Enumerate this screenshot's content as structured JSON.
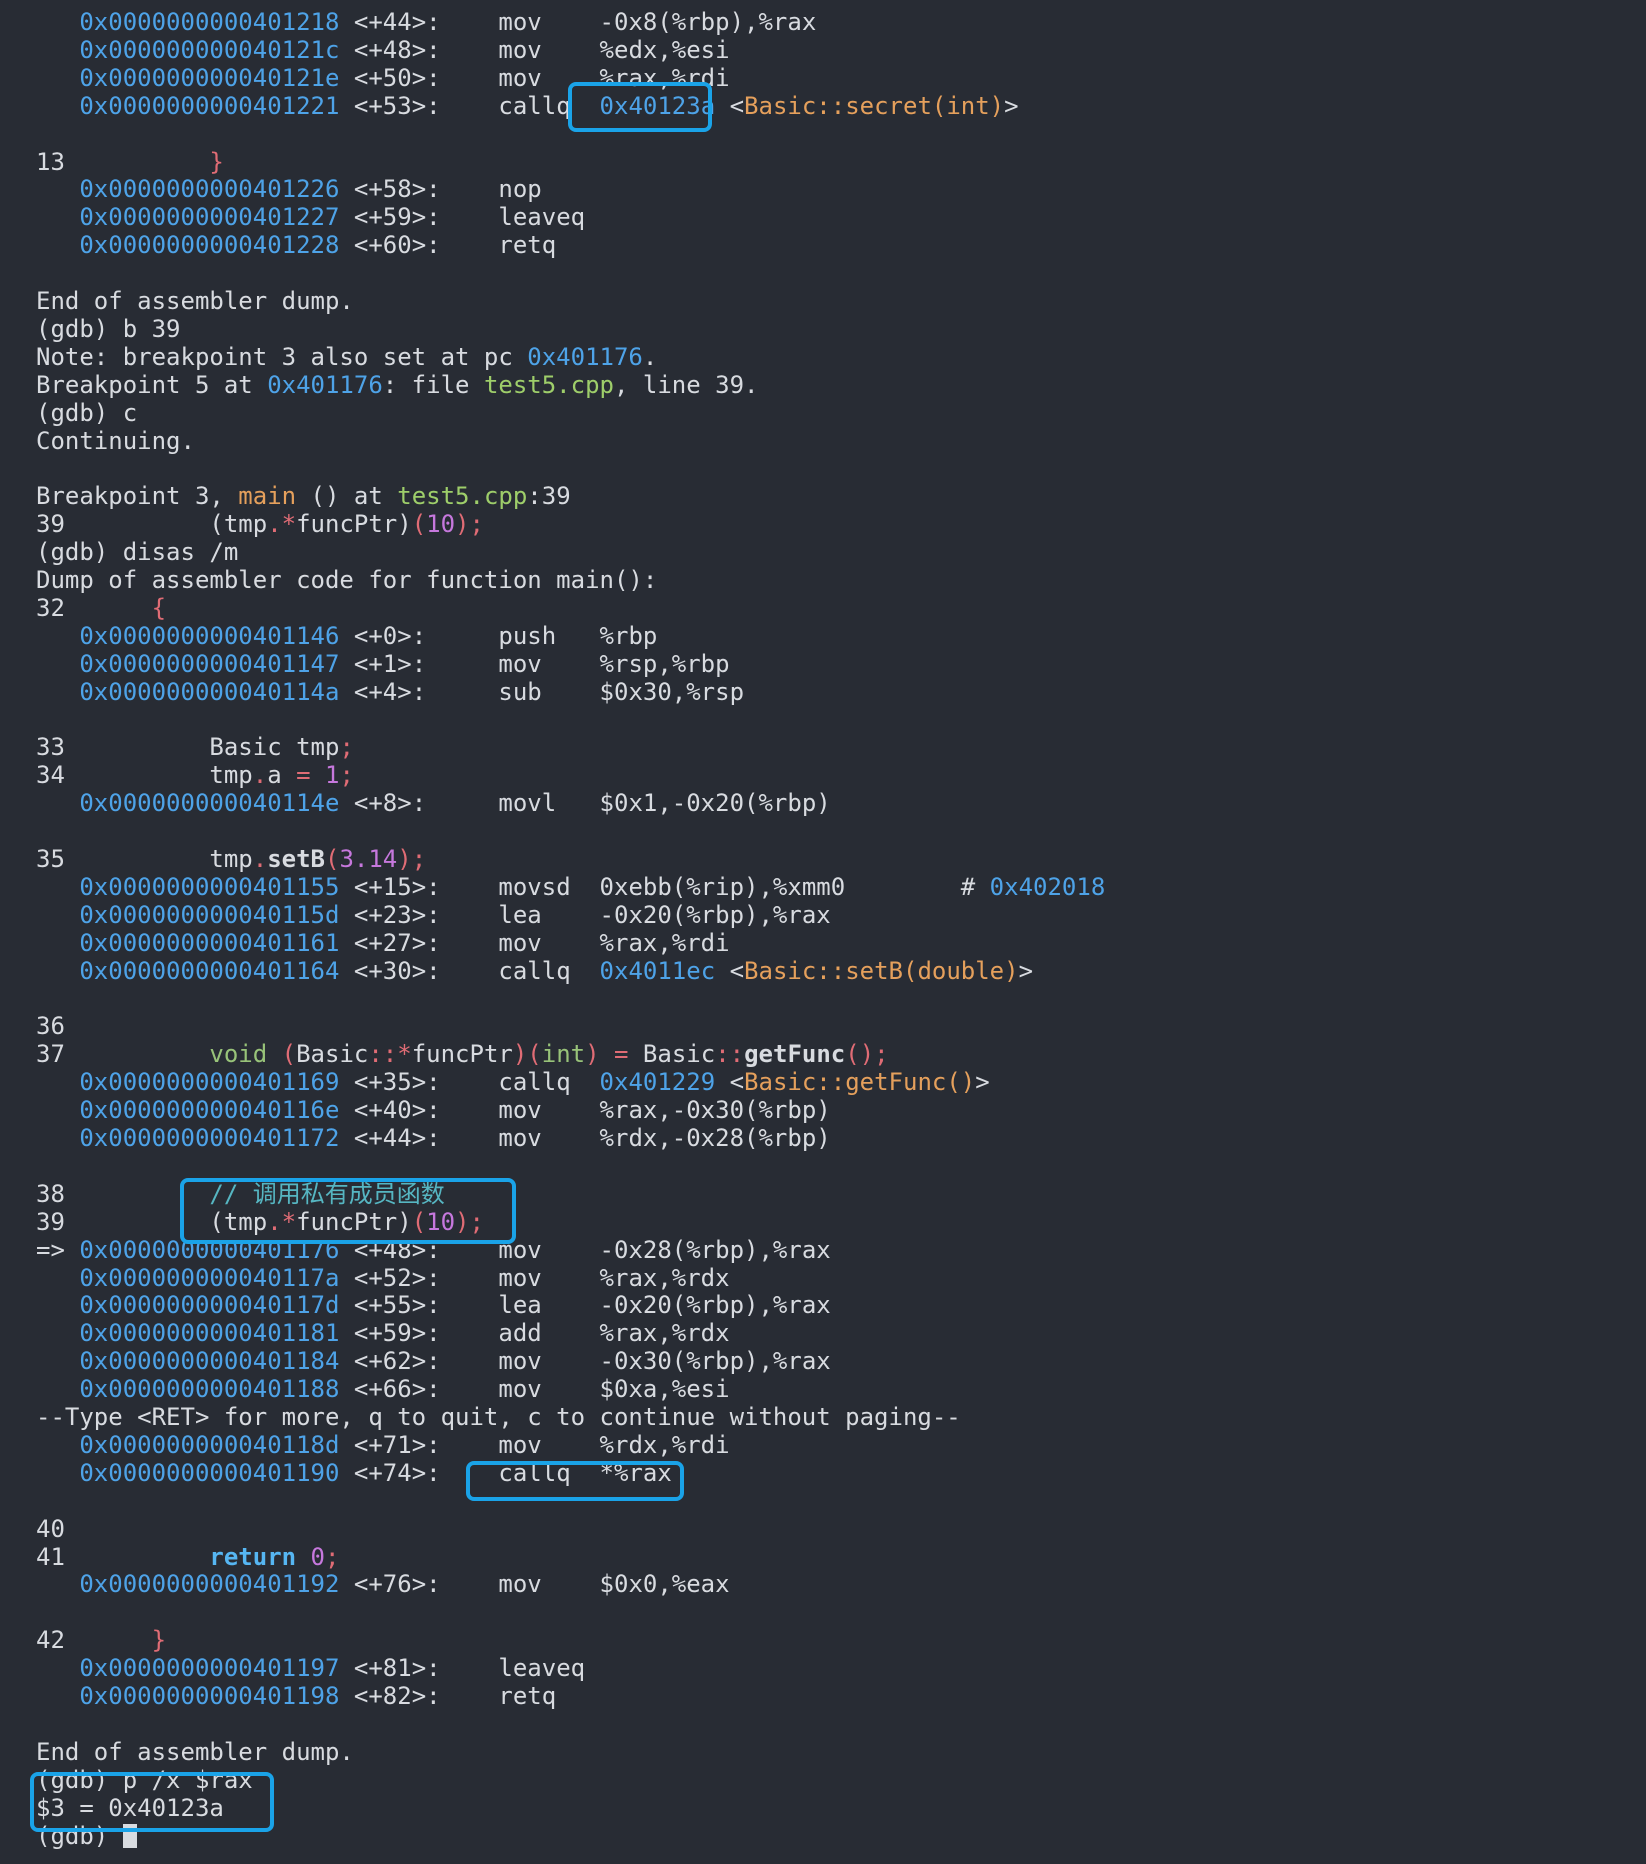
{
  "terminal": {
    "lines": [
      [
        {
          "t": "   "
        },
        {
          "t": "0x0000000000401218",
          "c": "addr"
        },
        {
          "t": " <+44>:    mov    -0x8(%rbp),%rax"
        }
      ],
      [
        {
          "t": "   "
        },
        {
          "t": "0x000000000040121c",
          "c": "addr"
        },
        {
          "t": " <+48>:    mov    %edx,%esi"
        }
      ],
      [
        {
          "t": "   "
        },
        {
          "t": "0x000000000040121e",
          "c": "addr"
        },
        {
          "t": " <+50>:    mov    %rax,%rdi"
        }
      ],
      [
        {
          "t": "   "
        },
        {
          "t": "0x0000000000401221",
          "c": "addr"
        },
        {
          "t": " <+53>:    callq  "
        },
        {
          "t": "0x40123a",
          "c": "addr"
        },
        {
          "t": " <"
        },
        {
          "t": "Basic::secret(int)",
          "c": "sym"
        },
        {
          "t": ">"
        }
      ],
      [],
      [
        {
          "t": "13          "
        },
        {
          "t": "}",
          "c": "brace"
        }
      ],
      [
        {
          "t": "   "
        },
        {
          "t": "0x0000000000401226",
          "c": "addr"
        },
        {
          "t": " <+58>:    nop"
        }
      ],
      [
        {
          "t": "   "
        },
        {
          "t": "0x0000000000401227",
          "c": "addr"
        },
        {
          "t": " <+59>:    leaveq"
        }
      ],
      [
        {
          "t": "   "
        },
        {
          "t": "0x0000000000401228",
          "c": "addr"
        },
        {
          "t": " <+60>:    retq"
        }
      ],
      [],
      [
        {
          "t": "End of assembler dump."
        }
      ],
      [
        {
          "t": "(gdb) b 39"
        }
      ],
      [
        {
          "t": "Note: breakpoint 3 also set at pc "
        },
        {
          "t": "0x401176",
          "c": "addr"
        },
        {
          "t": "."
        }
      ],
      [
        {
          "t": "Breakpoint 5 at "
        },
        {
          "t": "0x401176",
          "c": "addr"
        },
        {
          "t": ": file "
        },
        {
          "t": "test5.cpp",
          "c": "file"
        },
        {
          "t": ", line 39."
        }
      ],
      [
        {
          "t": "(gdb) c"
        }
      ],
      [
        {
          "t": "Continuing."
        }
      ],
      [],
      [
        {
          "t": "Breakpoint 3, "
        },
        {
          "t": "main",
          "c": "sym"
        },
        {
          "t": " () at "
        },
        {
          "t": "test5.cpp",
          "c": "file"
        },
        {
          "t": ":39"
        }
      ],
      [
        {
          "t": "39          "
        },
        {
          "t": "(tmp"
        },
        {
          "t": ".*",
          "c": "op"
        },
        {
          "t": "funcPtr)"
        },
        {
          "t": "(",
          "c": "op"
        },
        {
          "t": "10",
          "c": "num"
        },
        {
          "t": ");",
          "c": "op"
        }
      ],
      [
        {
          "t": "(gdb) disas /m"
        }
      ],
      [
        {
          "t": "Dump of assembler code for function main():"
        }
      ],
      [
        {
          "t": "32      "
        },
        {
          "t": "{",
          "c": "brace"
        }
      ],
      [
        {
          "t": "   "
        },
        {
          "t": "0x0000000000401146",
          "c": "addr"
        },
        {
          "t": " <+0>:     push   %rbp"
        }
      ],
      [
        {
          "t": "   "
        },
        {
          "t": "0x0000000000401147",
          "c": "addr"
        },
        {
          "t": " <+1>:     mov    %rsp,%rbp"
        }
      ],
      [
        {
          "t": "   "
        },
        {
          "t": "0x000000000040114a",
          "c": "addr"
        },
        {
          "t": " <+4>:     sub    $0x30,%rsp"
        }
      ],
      [],
      [
        {
          "t": "33          Basic tmp"
        },
        {
          "t": ";",
          "c": "op"
        }
      ],
      [
        {
          "t": "34          tmp"
        },
        {
          "t": ".",
          "c": "op"
        },
        {
          "t": "a "
        },
        {
          "t": "=",
          "c": "op"
        },
        {
          "t": " "
        },
        {
          "t": "1",
          "c": "num"
        },
        {
          "t": ";",
          "c": "op"
        }
      ],
      [
        {
          "t": "   "
        },
        {
          "t": "0x000000000040114e",
          "c": "addr"
        },
        {
          "t": " <+8>:     movl   $0x1,-0x20(%rbp)"
        }
      ],
      [],
      [
        {
          "t": "35          tmp"
        },
        {
          "t": ".",
          "c": "op"
        },
        {
          "t": "setB",
          "c": "fn"
        },
        {
          "t": "(",
          "c": "op"
        },
        {
          "t": "3.14",
          "c": "num"
        },
        {
          "t": ");",
          "c": "op"
        }
      ],
      [
        {
          "t": "   "
        },
        {
          "t": "0x0000000000401155",
          "c": "addr"
        },
        {
          "t": " <+15>:    movsd  0xebb(%rip),%xmm0        # "
        },
        {
          "t": "0x402018",
          "c": "addr"
        }
      ],
      [
        {
          "t": "   "
        },
        {
          "t": "0x000000000040115d",
          "c": "addr"
        },
        {
          "t": " <+23>:    lea    -0x20(%rbp),%rax"
        }
      ],
      [
        {
          "t": "   "
        },
        {
          "t": "0x0000000000401161",
          "c": "addr"
        },
        {
          "t": " <+27>:    mov    %rax,%rdi"
        }
      ],
      [
        {
          "t": "   "
        },
        {
          "t": "0x0000000000401164",
          "c": "addr"
        },
        {
          "t": " <+30>:    callq  "
        },
        {
          "t": "0x4011ec",
          "c": "addr"
        },
        {
          "t": " <"
        },
        {
          "t": "Basic::setB(double)",
          "c": "sym"
        },
        {
          "t": ">"
        }
      ],
      [],
      [
        {
          "t": "36"
        }
      ],
      [
        {
          "t": "37          "
        },
        {
          "t": "void",
          "c": "kw"
        },
        {
          "t": " "
        },
        {
          "t": "(",
          "c": "op"
        },
        {
          "t": "Basic"
        },
        {
          "t": "::*",
          "c": "op"
        },
        {
          "t": "funcPtr"
        },
        {
          "t": ")(",
          "c": "op"
        },
        {
          "t": "int",
          "c": "kw"
        },
        {
          "t": ")",
          "c": "op"
        },
        {
          "t": " "
        },
        {
          "t": "=",
          "c": "op"
        },
        {
          "t": " Basic"
        },
        {
          "t": "::",
          "c": "op"
        },
        {
          "t": "getFunc",
          "c": "fn"
        },
        {
          "t": "();",
          "c": "op"
        }
      ],
      [
        {
          "t": "   "
        },
        {
          "t": "0x0000000000401169",
          "c": "addr"
        },
        {
          "t": " <+35>:    callq  "
        },
        {
          "t": "0x401229",
          "c": "addr"
        },
        {
          "t": " <"
        },
        {
          "t": "Basic::getFunc()",
          "c": "sym"
        },
        {
          "t": ">"
        }
      ],
      [
        {
          "t": "   "
        },
        {
          "t": "0x000000000040116e",
          "c": "addr"
        },
        {
          "t": " <+40>:    mov    %rax,-0x30(%rbp)"
        }
      ],
      [
        {
          "t": "   "
        },
        {
          "t": "0x0000000000401172",
          "c": "addr"
        },
        {
          "t": " <+44>:    mov    %rdx,-0x28(%rbp)"
        }
      ],
      [],
      [
        {
          "t": "38          "
        },
        {
          "t": "// 调用私有成员函数",
          "c": "comment"
        }
      ],
      [
        {
          "t": "39          "
        },
        {
          "t": "(tmp"
        },
        {
          "t": ".*",
          "c": "op"
        },
        {
          "t": "funcPtr)"
        },
        {
          "t": "(",
          "c": "op"
        },
        {
          "t": "10",
          "c": "num"
        },
        {
          "t": ");",
          "c": "op"
        }
      ],
      [
        {
          "t": "=> "
        },
        {
          "t": "0x0000000000401176",
          "c": "addr"
        },
        {
          "t": " <+48>:    mov    -0x28(%rbp),%rax"
        }
      ],
      [
        {
          "t": "   "
        },
        {
          "t": "0x000000000040117a",
          "c": "addr"
        },
        {
          "t": " <+52>:    mov    %rax,%rdx"
        }
      ],
      [
        {
          "t": "   "
        },
        {
          "t": "0x000000000040117d",
          "c": "addr"
        },
        {
          "t": " <+55>:    lea    -0x20(%rbp),%rax"
        }
      ],
      [
        {
          "t": "   "
        },
        {
          "t": "0x0000000000401181",
          "c": "addr"
        },
        {
          "t": " <+59>:    add    %rax,%rdx"
        }
      ],
      [
        {
          "t": "   "
        },
        {
          "t": "0x0000000000401184",
          "c": "addr"
        },
        {
          "t": " <+62>:    mov    -0x30(%rbp),%rax"
        }
      ],
      [
        {
          "t": "   "
        },
        {
          "t": "0x0000000000401188",
          "c": "addr"
        },
        {
          "t": " <+66>:    mov    $0xa,%esi"
        }
      ],
      [
        {
          "t": "--Type <RET> for more, q to quit, c to continue without paging--"
        }
      ],
      [
        {
          "t": "   "
        },
        {
          "t": "0x000000000040118d",
          "c": "addr"
        },
        {
          "t": " <+71>:    mov    %rdx,%rdi"
        }
      ],
      [
        {
          "t": "   "
        },
        {
          "t": "0x0000000000401190",
          "c": "addr"
        },
        {
          "t": " <+74>:    callq  *%rax"
        }
      ],
      [],
      [
        {
          "t": "40"
        }
      ],
      [
        {
          "t": "41          "
        },
        {
          "t": "return",
          "c": "ret"
        },
        {
          "t": " "
        },
        {
          "t": "0",
          "c": "num"
        },
        {
          "t": ";",
          "c": "op"
        }
      ],
      [
        {
          "t": "   "
        },
        {
          "t": "0x0000000000401192",
          "c": "addr"
        },
        {
          "t": " <+76>:    mov    $0x0,%eax"
        }
      ],
      [],
      [
        {
          "t": "42      "
        },
        {
          "t": "}",
          "c": "brace"
        }
      ],
      [
        {
          "t": "   "
        },
        {
          "t": "0x0000000000401197",
          "c": "addr"
        },
        {
          "t": " <+81>:    leaveq"
        }
      ],
      [
        {
          "t": "   "
        },
        {
          "t": "0x0000000000401198",
          "c": "addr"
        },
        {
          "t": " <+82>:    retq"
        }
      ],
      [],
      [
        {
          "t": "End of assembler dump."
        }
      ],
      [
        {
          "t": "(gdb) p /x $rax"
        }
      ],
      [
        {
          "t": "$3 = 0x40123a"
        }
      ],
      [
        {
          "t": "(gdb) "
        }
      ]
    ]
  },
  "colors": {
    "background": "#282c34",
    "text": "#d8dbe0",
    "address": "#4ea3e8",
    "symbol": "#e5a05c",
    "file": "#9ece6a",
    "keyword": "#98c379",
    "number": "#c678dd",
    "operator": "#e06c75",
    "comment": "#56b6c2",
    "highlight_box": "#1aa3e8"
  }
}
